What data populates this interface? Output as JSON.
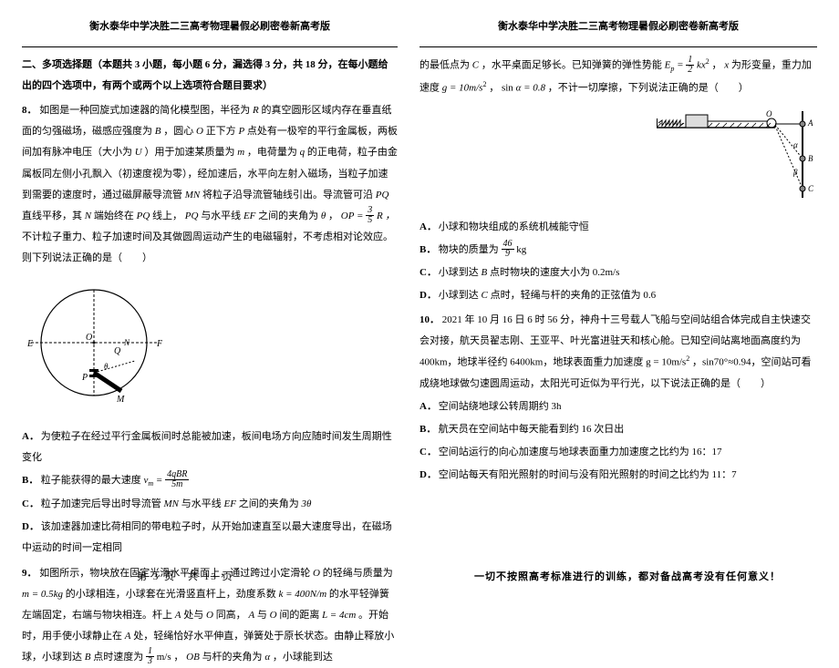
{
  "header": "衡水泰华中学决胜二三高考物理暑假必刷密卷新高考版",
  "left": {
    "section2_title": "二、多项选择题（本题共 3 小题，每小题 6 分，漏选得 3 分，共 18 分，在每小题给出的四个选项中，有两个或两个以上选项符合题目要求）",
    "q8": {
      "num": "8．",
      "body_parts": [
        "如图是一种回旋式加速器的简化模型图，半径为",
        "的真空圆形区域内存在垂直纸面的匀强磁场，磁感应强度为",
        "，圆心",
        "正下方",
        "点处有一极窄的平行金属板，两板间加有脉冲电压（大小为",
        "）用于加速某质量为",
        "，电荷量为",
        "的正电荷，粒子由金属板同左侧小孔飘入（初速度视为零），经加速后，水平向左射入磁场，当粒子加速到需要的速度时，通过磁屏蔽导流管",
        "将粒子沿导流管轴线引出。导流管可沿",
        "直线平移，其",
        "端始终在",
        "线上，",
        "与水平线",
        "之间的夹角为",
        "，",
        "不计粒子重力、粒子加速时间及其做圆周运动产生的电磁辐射，不考虑相对论效应。则下列说法正确的是（　　）"
      ],
      "R": "R",
      "B": "B",
      "O": "O",
      "P": "P",
      "U": "U",
      "m": "m",
      "q": "q",
      "MN": "MN",
      "PQ": "PQ",
      "N": "N",
      "EF": "EF",
      "theta": "θ",
      "OP_eq": "OP =",
      "OP_num": "3",
      "OP_den": "5",
      "OP_R": "R ，",
      "options": {
        "A": "为使粒子在经过平行金属板间时总能被加速，板间电场方向应随时间发生周期性变化",
        "B_pre": "粒子能获得的最大速度",
        "B_vm": "v",
        "B_sub": "m",
        "B_eq": " = ",
        "B_num": "4qBR",
        "B_den": "5m",
        "C_pre": "粒子加速完后导出时导流管",
        "C_mn": "MN",
        "C_mid": "与水平线",
        "C_ef": "EF",
        "C_post": "之间的夹角为",
        "C_val": "3θ",
        "D": "该加速器加速比荷相同的带电粒子时，从开始加速直至以最大速度导出，在磁场中运动的时间一定相同"
      }
    },
    "q9": {
      "num": "9．",
      "body": "如图所示，物块放在固定光滑水平桌面上，通过跨过小定滑轮",
      "O1": "O",
      "body2": "的轻绳与质量为",
      "m_eq": "m = 0.5kg",
      "body3": "的小球相连，小球套在光滑竖直杆上，劲度系数",
      "k_eq": "k = 400N/m",
      "body4": "的水平轻弹簧左端固定，右端与物块相连。杆上",
      "A": "A",
      "body5": "处与",
      "O2": "O",
      "body6": "同高，",
      "A2": "A",
      "body7": "与",
      "O3": "O",
      "body8": "间的距离",
      "L_eq": "L = 4cm",
      "body9": "。开始时，用手使小球静止在",
      "A3": "A",
      "body10": "处，轻绳恰好水平伸直，弹簧处于原长状态。由静止释放小球，小球到达",
      "B2": "B",
      "body11": "点时速度为",
      "v_num": "1",
      "v_den": "3",
      "v_unit": "m/s",
      "body12": "，",
      "OB": "OB",
      "body13": "与杆的夹角为",
      "alpha": "α",
      "body14": "，小球能到达"
    }
  },
  "right": {
    "q9_cont": {
      "body1": "的最低点为",
      "C": "C",
      "body2": "，水平桌面足够长。已知弹簧的弹性势能",
      "Ep": "E",
      "Ep_sub": "p",
      "eq": " = ",
      "half_num": "1",
      "half_den": "2",
      "kx2": "kx",
      "sq": "2",
      "comma": " ，",
      "x": "x",
      "body3": "为形变量，重力加速度",
      "g_eq": "g = 10m/s",
      "g_sq": "2",
      "body4": "sin",
      "alpha2": "α",
      "sina_eq": " = 0.8",
      "body5": "，不计一切摩擦，下列说法正确的是（　　）"
    },
    "q9_options": {
      "A": "小球和物块组成的系统机械能守恒",
      "B_pre": "物块的质量为",
      "B_num": "46",
      "B_den": "9",
      "B_unit": "kg",
      "C_pre": "小球到达",
      "C_B": "B",
      "C_post": "点时物块的速度大小为 0.2m/s",
      "D_pre": "小球到达",
      "D_C": "C",
      "D_post": "点时，轻绳与杆的夹角的正弦值为 0.6"
    },
    "q10": {
      "num": "10．",
      "body1": "2021 年 10 月 16 日 6 时 56 分，神舟十三号载人飞船与空间站组合体完成自主快速交会对接，航天员翟志刚、王亚平、叶光富进驻天和核心舱。已知空间站离地面高度约为 400km，地球半径约 6400km，地球表面重力加速度 g = 10m/s",
      "sq": "2",
      "body2": "，sin70°≈0.94，空间站可看成绕地球做匀速圆周运动，太阳光可近似为平行光，以下说法正确的是（　　）",
      "options": {
        "A": "空间站绕地球公转周期约 3h",
        "B": "航天员在空间站中每天能看到约 16 次日出",
        "C": "空间站运行的向心加速度与地球表面重力加速度之比约为 16：17",
        "D": "空间站每天有阳光照射的时间与没有阳光照射的时间之比约为 11：7"
      }
    }
  },
  "footer": {
    "left_pre": "第 ",
    "left_page": "3",
    "left_mid": " 页　共 ",
    "left_total": "13",
    "left_post": " 页",
    "right": "一切不按照高考标准进行的训练，都对备战高考没有任何意义！"
  }
}
